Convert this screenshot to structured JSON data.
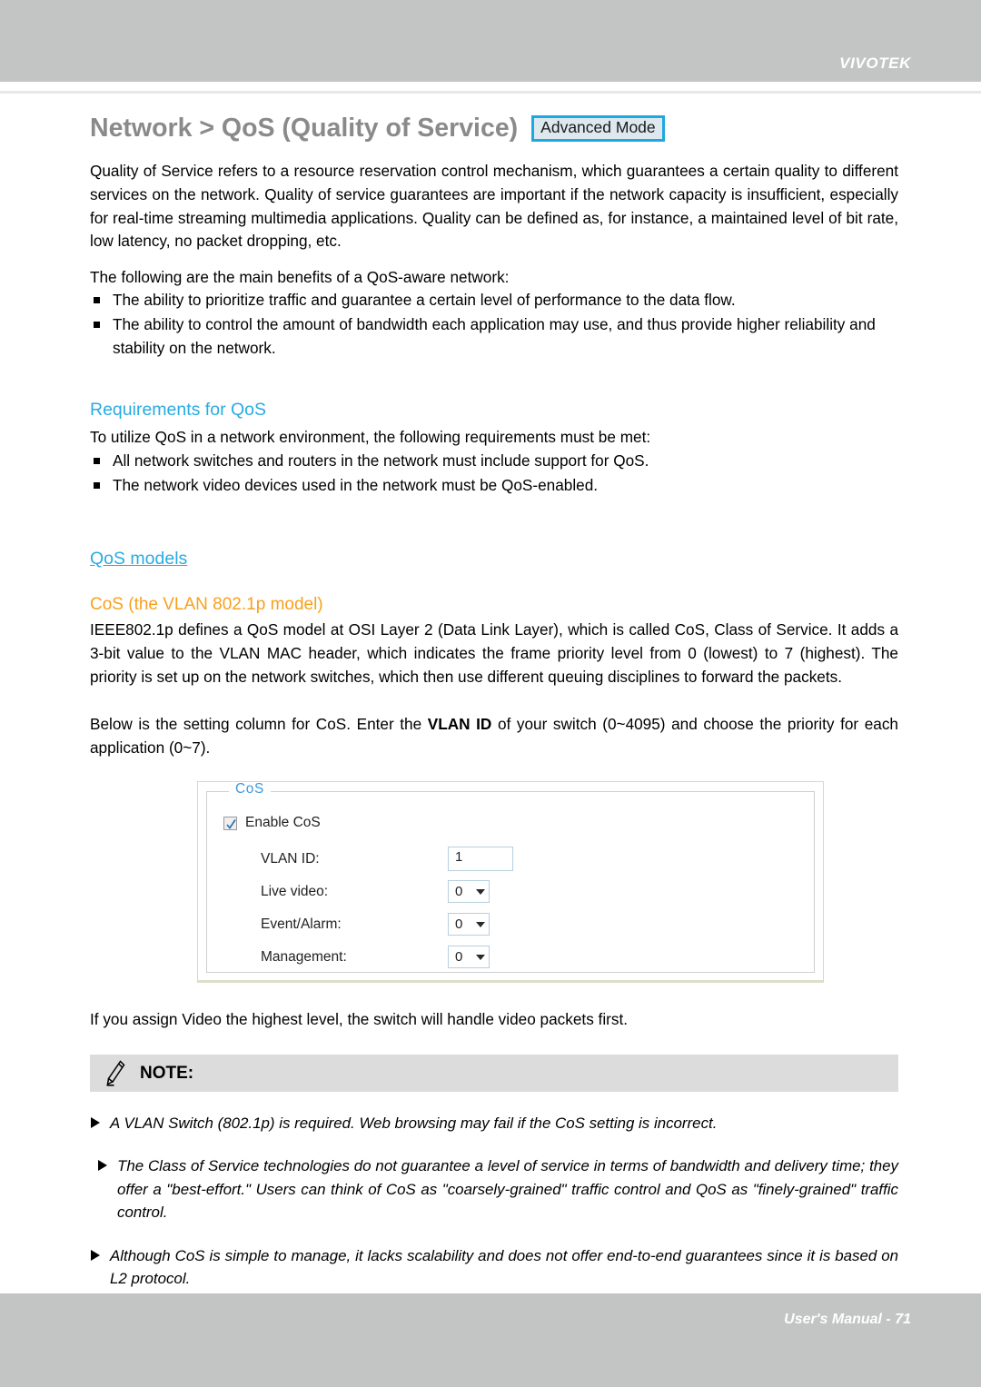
{
  "header": {
    "brand": "VIVOTEK"
  },
  "title": {
    "text": "Network > QoS (Quality of Service)",
    "badge": "Advanced Mode"
  },
  "intro": {
    "paragraph": "Quality of Service refers to a resource reservation control mechanism, which guarantees a certain quality to different services on the network. Quality of service guarantees are important if the network capacity is insufficient, especially for real-time streaming multimedia applications. Quality can be defined as, for instance, a maintained level of bit rate, low latency, no packet dropping, etc.",
    "benefits_lead": "The following are the main benefits of a QoS-aware network:",
    "benefits": [
      "The ability to prioritize traffic and guarantee a certain level of performance to the data flow.",
      "The ability to control the amount of bandwidth each application may use, and thus provide higher reliability and stability on the network."
    ]
  },
  "requirements": {
    "heading": "Requirements for QoS",
    "lead": "To utilize QoS in a network environment, the following requirements must be met:",
    "items": [
      "All network switches and routers in the network must include support for QoS.",
      "The network video devices used in the network must be QoS-enabled."
    ]
  },
  "models": {
    "heading": "QoS models",
    "cos_heading": "CoS (the VLAN 802.1p model)",
    "cos_paragraph": "IEEE802.1p defines a QoS model at OSI Layer 2 (Data Link Layer), which is called CoS, Class of Service. It adds a 3-bit value to the VLAN MAC header, which indicates the frame priority level from 0 (lowest) to 7 (highest). The priority is set up on the network switches, which then use different queuing disciplines to forward the packets.",
    "setting_intro_pre": "Below is the setting column for CoS. Enter the ",
    "setting_intro_bold": "VLAN ID",
    "setting_intro_post": " of your switch (0~4095) and choose the priority for each application (0~7)."
  },
  "cos_panel": {
    "legend": "CoS",
    "enable_label": "Enable CoS",
    "enable_checked": true,
    "fields": [
      {
        "label": "VLAN ID:",
        "value": "1",
        "control": "text"
      },
      {
        "label": "Live video:",
        "value": "0",
        "control": "select"
      },
      {
        "label": "Event/Alarm:",
        "value": "0",
        "control": "select"
      },
      {
        "label": "Management:",
        "value": "0",
        "control": "select"
      }
    ]
  },
  "after_panel": {
    "paragraph": "If you assign Video the highest level, the switch will handle video packets first."
  },
  "note": {
    "label": "NOTE:",
    "items": [
      "A VLAN Switch (802.1p) is required. Web browsing may fail if the CoS setting is incorrect.",
      "The Class of Service technologies do not guarantee a level of service in terms of bandwidth and delivery time; they offer a \"best-effort.\" Users can think of CoS as \"coarsely-grained\" traffic control and QoS as \"finely-grained\" traffic control.",
      "Although CoS is simple to manage, it lacks scalability and does not offer end-to-end guarantees since it is based on L2 protocol."
    ]
  },
  "footer": {
    "text": "User's Manual - 71"
  },
  "colors": {
    "band": "#c3c4c4",
    "accent_blue": "#29abe2",
    "accent_orange": "#f8a01c",
    "badge_border": "#1fa8e0",
    "badge_fill": "#dde8ef",
    "note_bar": "#dcdcdc"
  }
}
